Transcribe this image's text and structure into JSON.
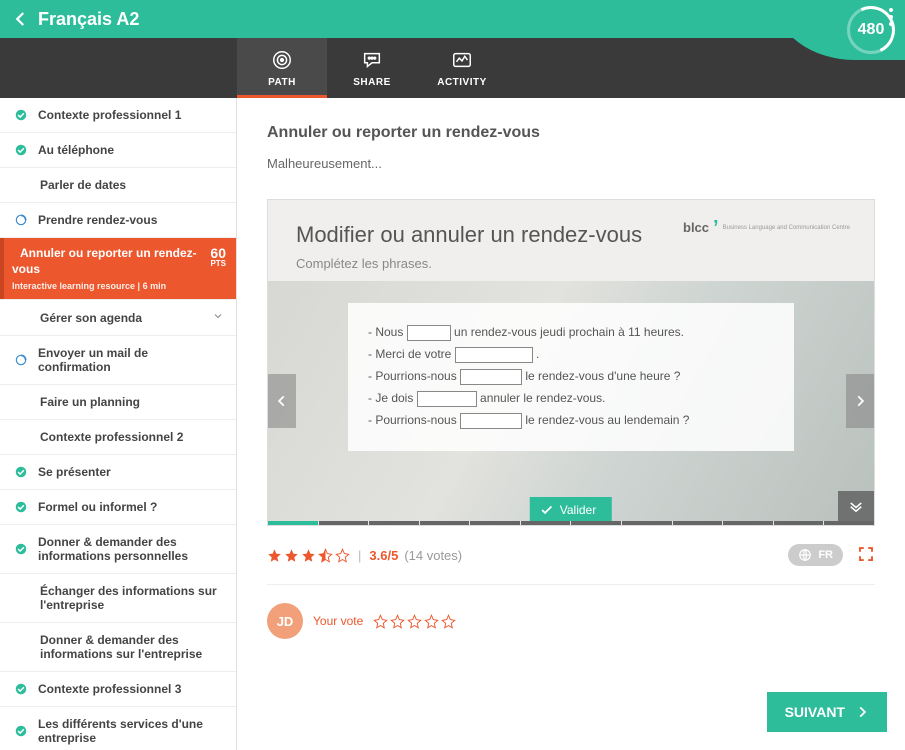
{
  "header": {
    "title": "Français A2",
    "score": "480"
  },
  "tabs": [
    {
      "id": "path",
      "label": "PATH",
      "active": true
    },
    {
      "id": "share",
      "label": "SHARE",
      "active": false
    },
    {
      "id": "activity",
      "label": "ACTIVITY",
      "active": false
    }
  ],
  "sidebar": [
    {
      "icon": "check",
      "label": "Contexte professionnel 1"
    },
    {
      "icon": "check",
      "label": "Au téléphone"
    },
    {
      "icon": "none",
      "label": "Parler de dates",
      "indent": true
    },
    {
      "icon": "circle",
      "label": "Prendre rendez-vous"
    },
    {
      "icon": "active",
      "label": "Annuler ou reporter un rendez-vous",
      "meta": "Interactive learning resource | 6 min",
      "pts": "60",
      "pts_unit": "PTS"
    },
    {
      "icon": "none",
      "label": "Gérer son agenda",
      "indent": true,
      "chevron": true
    },
    {
      "icon": "circle",
      "label": "Envoyer un mail de confirmation"
    },
    {
      "icon": "none",
      "label": "Faire un planning",
      "indent": true
    },
    {
      "icon": "none",
      "label": "Contexte professionnel 2",
      "indent": true
    },
    {
      "icon": "check",
      "label": "Se présenter"
    },
    {
      "icon": "check",
      "label": "Formel ou informel ?"
    },
    {
      "icon": "check",
      "label": "Donner & demander des informations personnelles"
    },
    {
      "icon": "none",
      "label": "Échanger des informations sur l'entreprise",
      "indent": true
    },
    {
      "icon": "none",
      "label": "Donner & demander des informations sur l'entreprise",
      "indent": true
    },
    {
      "icon": "check",
      "label": "Contexte professionnel 3"
    },
    {
      "icon": "check",
      "label": "Les différents services d'une entreprise"
    }
  ],
  "content": {
    "title": "Annuler ou reporter un rendez-vous",
    "subtitle": "Malheureusement...",
    "preview": {
      "title": "Modifier ou annuler un rendez-vous",
      "subtitle": "Complétez les phrases.",
      "brand": "blcc",
      "brand_sub": "Business Language and Communication Centre",
      "lines": {
        "l1a": "- Nous ",
        "l1b": " un rendez-vous jeudi prochain à 11 heures.",
        "l2a": "- Merci de votre ",
        "l2b": " .",
        "l3a": "- Pourrions-nous ",
        "l3b": " le rendez-vous d'une heure ?",
        "l4a": "- Je dois ",
        "l4b": " annuler le rendez-vous.",
        "l5a": "- Pourrions-nous ",
        "l5b": " le rendez-vous au lendemain ?"
      },
      "validate": "Valider"
    },
    "rating": {
      "score": "3.6/5",
      "votes": "(14 votes)",
      "lang": "FR"
    },
    "vote": {
      "initials": "JD",
      "label": "Your vote"
    },
    "next": "SUIVANT"
  }
}
